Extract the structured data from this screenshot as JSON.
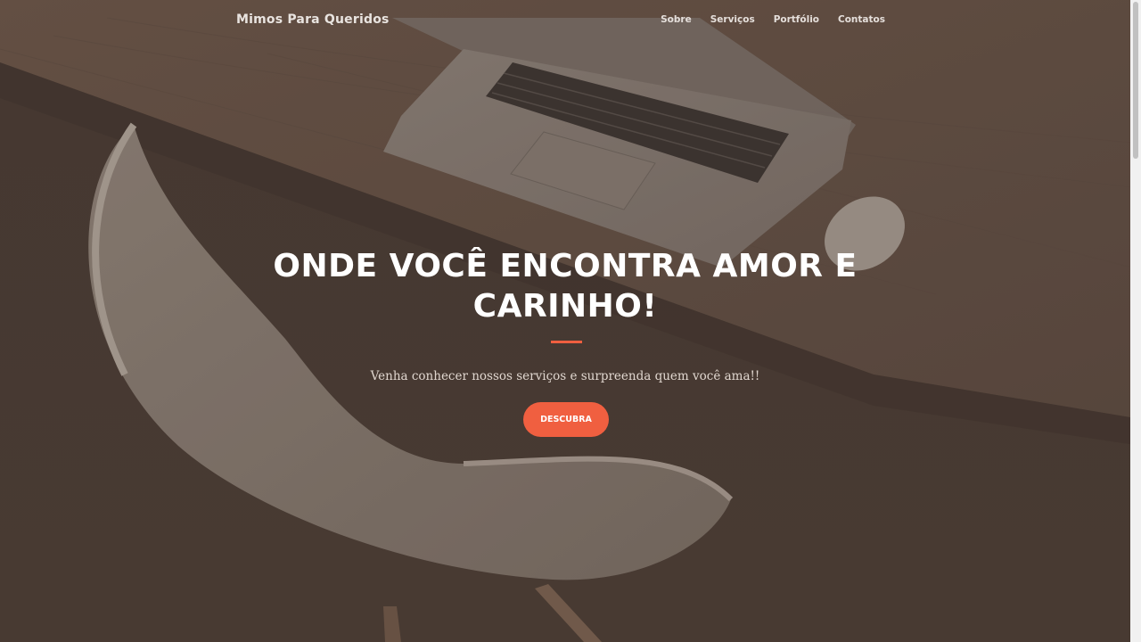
{
  "navbar": {
    "brand": "Mimos Para Queridos",
    "links": [
      {
        "label": "Sobre"
      },
      {
        "label": "Serviços"
      },
      {
        "label": "Portfólio"
      },
      {
        "label": "Contatos"
      }
    ]
  },
  "hero": {
    "title_line1": "ONDE VOCÊ ENCONTRA AMOR E",
    "title_line2": "CARINHO!",
    "subtitle": "Venha conhecer nossos serviços e surpreenda quem você ama!!",
    "cta_label": "DESCUBRA"
  },
  "colors": {
    "accent": "#f05f40",
    "overlay": "#4b3e36",
    "text_primary": "#ffffff"
  }
}
